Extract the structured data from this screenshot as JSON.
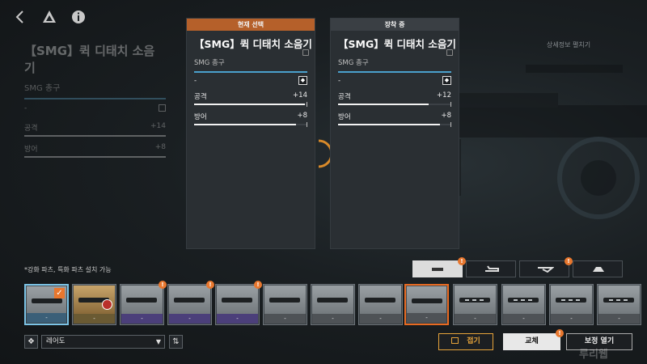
{
  "nav": {
    "back_icon": "chevron-left-icon",
    "logo_icon": "game-logo-icon",
    "info_icon": "info-icon"
  },
  "left_panel": {
    "title": "【SMG】퀵 디태치 소음기",
    "subtitle": "SMG 총구",
    "slot_value": "-",
    "stats": [
      {
        "label": "공격",
        "value": "+14"
      },
      {
        "label": "방어",
        "value": "+8"
      }
    ]
  },
  "compare": {
    "current": {
      "header": "현재 선택",
      "title": "【SMG】퀵 디태치 소음기",
      "subtitle": "SMG 총구",
      "slot_value": "-",
      "stats": [
        {
          "label": "공격",
          "value": "+14",
          "fill": 0.98
        },
        {
          "label": "방어",
          "value": "+8",
          "fill": 0.9
        }
      ]
    },
    "equipped": {
      "header": "장착 중",
      "title": "【SMG】퀵 디태치 소음기",
      "subtitle": "SMG 총구",
      "slot_value": "-",
      "stats": [
        {
          "label": "공격",
          "value": "+12",
          "fill": 0.8
        },
        {
          "label": "방어",
          "value": "+8",
          "fill": 0.9
        }
      ]
    }
  },
  "detail_link": "상세정보 펼치기",
  "note": "*강화 파츠, 특화 파츠 설치 가능",
  "category_tabs": [
    {
      "name": "muzzle",
      "badge": "!"
    },
    {
      "name": "grip",
      "badge": ""
    },
    {
      "name": "stock",
      "badge": "!"
    },
    {
      "name": "sight",
      "badge": ""
    }
  ],
  "parts": [
    {
      "footer": "-",
      "rarity": "blue",
      "checked": true,
      "badge": ""
    },
    {
      "footer": "-",
      "rarity": "gold",
      "checked": false,
      "badge": ""
    },
    {
      "footer": "-",
      "rarity": "purple",
      "checked": false,
      "badge": "!"
    },
    {
      "footer": "-",
      "rarity": "purple",
      "checked": false,
      "badge": "!"
    },
    {
      "footer": "-",
      "rarity": "purple",
      "checked": false,
      "badge": "!"
    },
    {
      "footer": "-",
      "rarity": "gray",
      "checked": false,
      "badge": ""
    },
    {
      "footer": "-",
      "rarity": "gray",
      "checked": false,
      "badge": ""
    },
    {
      "footer": "-",
      "rarity": "gray",
      "checked": false,
      "badge": ""
    },
    {
      "footer": "-",
      "rarity": "gray",
      "checked": false,
      "badge": ""
    },
    {
      "footer": "-",
      "rarity": "gray",
      "checked": false,
      "badge": ""
    },
    {
      "footer": "-",
      "rarity": "gray",
      "checked": false,
      "badge": ""
    },
    {
      "footer": "-",
      "rarity": "gray",
      "checked": false,
      "badge": ""
    },
    {
      "footer": "-",
      "rarity": "gray",
      "checked": false,
      "badge": ""
    }
  ],
  "controls": {
    "filter_icon": "filter-icon",
    "sort_select": "레어도",
    "sort_order_icon": "sort-order-icon"
  },
  "buttons": {
    "fold": "접기",
    "replace": "교체",
    "correct": "보정 열기"
  },
  "watermark": "루리웹",
  "colors": {
    "accent_orange": "#e8772e",
    "accent_blue": "#4aa0cc",
    "current_header": "#b5602a",
    "equipped_header": "#3a3f44"
  }
}
